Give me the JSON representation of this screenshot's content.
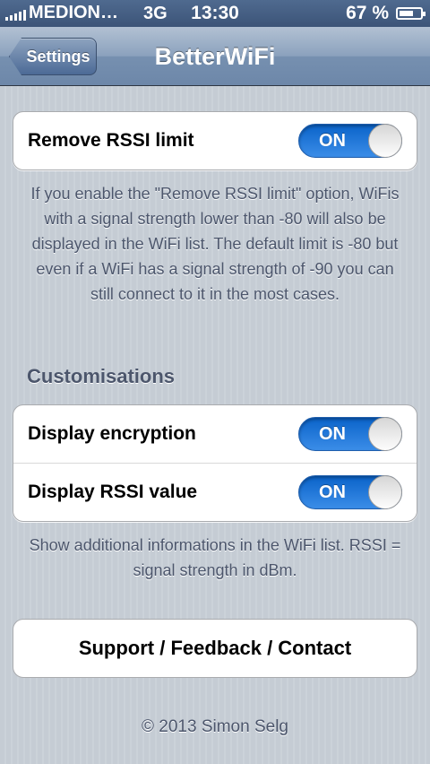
{
  "status_bar": {
    "carrier": "MEDION…",
    "network": "3G",
    "time": "13:30",
    "battery_percent": "67 %",
    "battery_level": 0.67
  },
  "nav": {
    "back_label": "Settings",
    "title": "BetterWiFi"
  },
  "rssi_group": {
    "label": "Remove RSSI limit",
    "toggle_text": "ON",
    "footer": "If you enable the \"Remove RSSI limit\" option, WiFis with a signal strength lower than -80 will also be displayed in the WiFi list. The default limit is -80 but even if a WiFi has a signal strength of -90 you can still connect to it in the most cases."
  },
  "customisations": {
    "header": "Customisations",
    "items": [
      {
        "label": "Display encryption",
        "toggle_text": "ON"
      },
      {
        "label": "Display RSSI value",
        "toggle_text": "ON"
      }
    ],
    "footer": "Show additional informations in the WiFi list. RSSI = signal strength in dBm."
  },
  "support_button": "Support / Feedback / Contact",
  "copyright": "© 2013 Simon Selg"
}
